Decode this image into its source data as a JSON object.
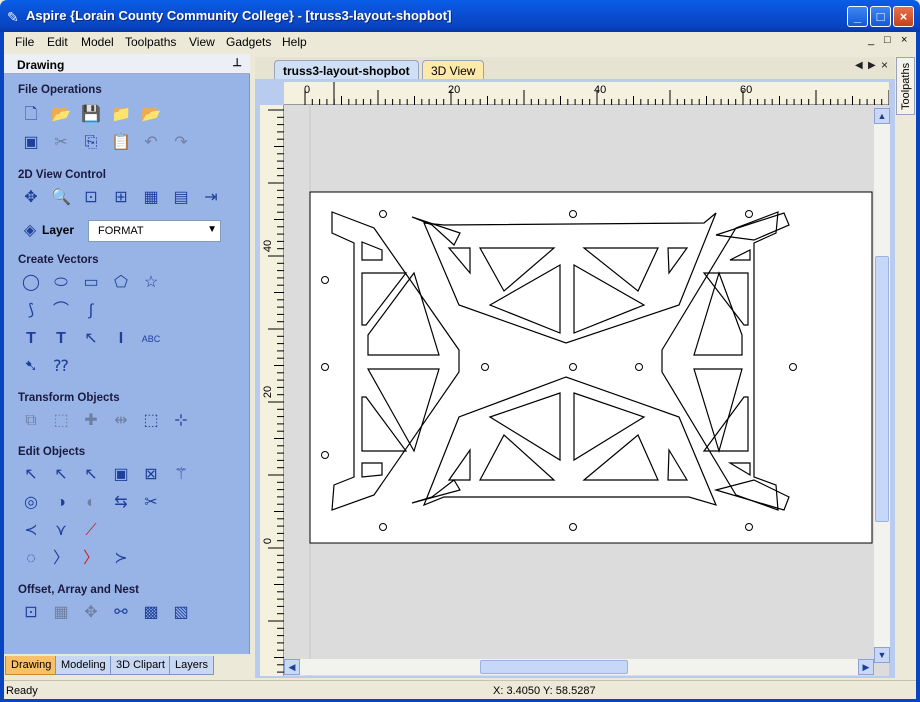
{
  "window": {
    "title": "Aspire {Lorain County Community College} - [truss3-layout-shopbot]",
    "controls": [
      "minimize-icon",
      "maximize-icon",
      "close-icon"
    ]
  },
  "menu": {
    "items": [
      "File",
      "Edit",
      "Model",
      "Toolpaths",
      "View",
      "Gadgets",
      "Help"
    ],
    "mdi_controls": [
      "_",
      "□",
      "×"
    ]
  },
  "panel": {
    "title": "Drawing",
    "pin": "⊥",
    "sections": {
      "file_ops": "File Operations",
      "view2d": "2D View Control",
      "create_vectors": "Create Vectors",
      "transform": "Transform Objects",
      "edit": "Edit Objects",
      "offset": "Offset, Array and Nest"
    },
    "layer_label": "Layer",
    "layer_value": "FORMAT",
    "bottom_tabs": [
      "Drawing",
      "Modeling",
      "3D Clipart",
      "Layers"
    ]
  },
  "document": {
    "tabs": [
      "truss3-layout-shopbot",
      "3D View"
    ],
    "ruler_h": [
      "0",
      "20",
      "40",
      "60"
    ],
    "ruler_v": [
      "40",
      "20",
      "0"
    ]
  },
  "right_strip": {
    "label": "Toolpaths"
  },
  "status": {
    "text": "Ready",
    "coords": "X:  3.4050 Y: 58.5287"
  }
}
